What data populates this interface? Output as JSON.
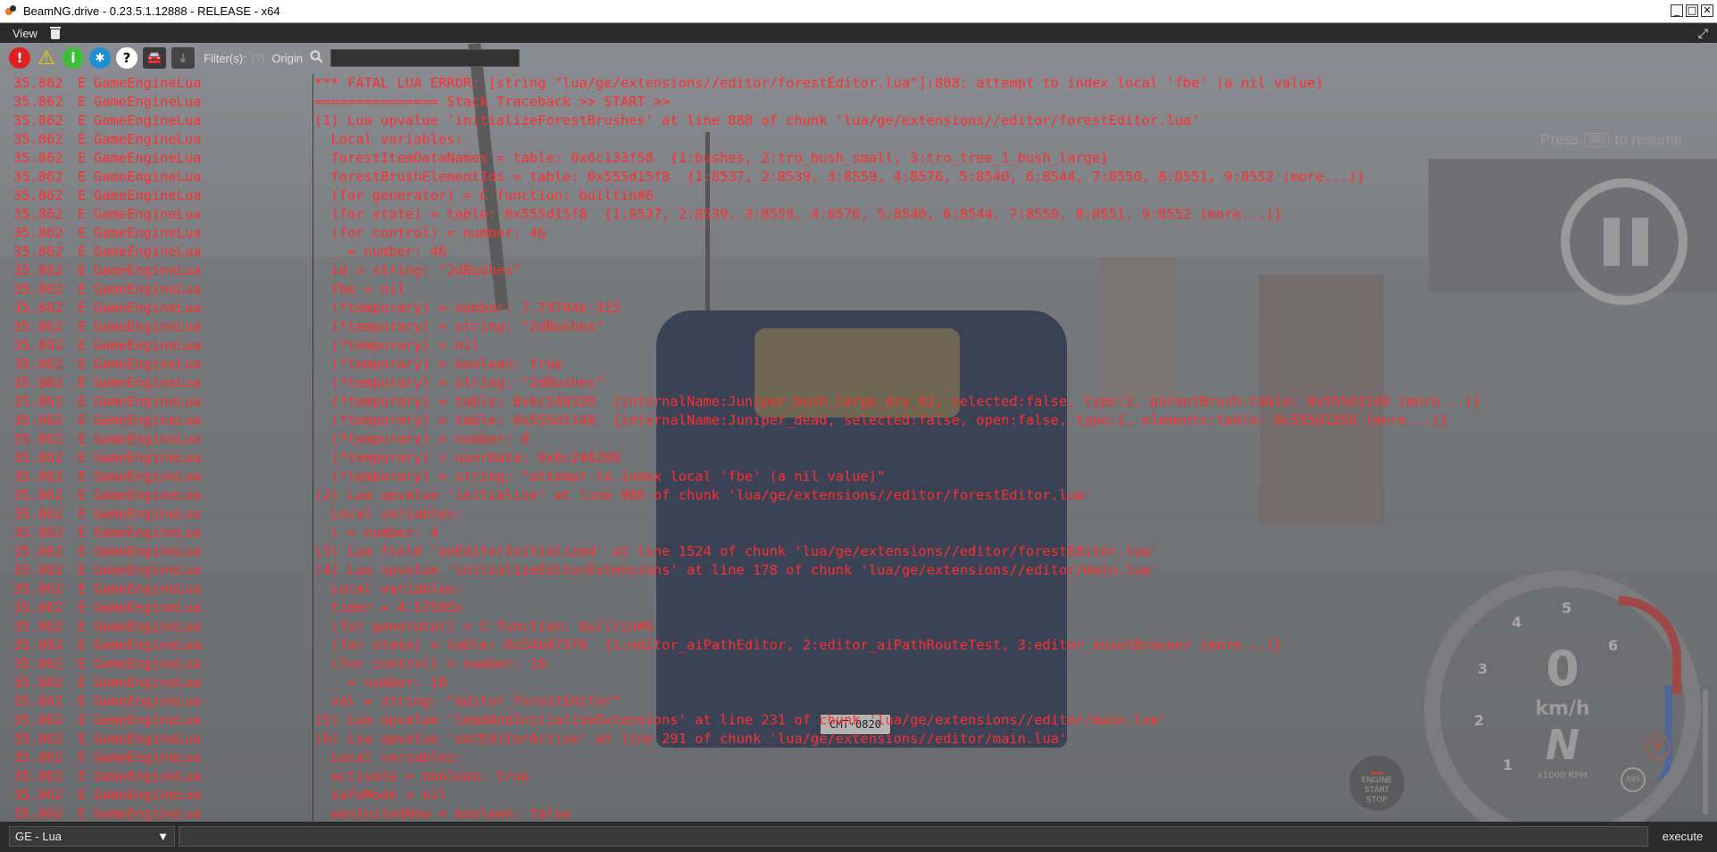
{
  "window": {
    "title": "BeamNG.drive - 0.23.5.1.12888 - RELEASE - x64",
    "minimize": "_",
    "maximize": "□",
    "close": "✕"
  },
  "menubar": {
    "view_label": "View",
    "expand_glyph": "⤢"
  },
  "toolbar": {
    "error_glyph": "!",
    "warning_glyph": "⚠",
    "info_glyph": "i",
    "debug_glyph": "✱",
    "help_glyph": "?",
    "car_glyph": "🚘",
    "download_glyph": "⤓",
    "filter_label": "Filter(s):",
    "filter_hint": "(?)",
    "origin_label": "Origin",
    "search_icon": "search-icon",
    "search_value": ""
  },
  "log": {
    "rows": [
      {
        "t": "35.862",
        "l": "E",
        "s": "GameEngineLua",
        "m": "*** FATAL LUA ERROR: [string \"lua/ge/extensions//editor/forestEditor.lua\"]:888: attempt to index local 'fbe' (a nil value)"
      },
      {
        "t": "35.862",
        "l": "E",
        "s": "GameEngineLua",
        "m": "=============== Stack Traceback >> START >>"
      },
      {
        "t": "35.862",
        "l": "E",
        "s": "GameEngineLua",
        "m": "(1) Lua upvalue 'initializeForestBrushes' at line 888 of chunk 'lua/ge/extensions//editor/forestEditor.lua'"
      },
      {
        "t": "35.862",
        "l": "E",
        "s": "GameEngineLua",
        "m": "  Local variables:"
      },
      {
        "t": "35.862",
        "l": "E",
        "s": "GameEngineLua",
        "m": "  forestItemDataNames = table: 0x6c133f58  {1:bushes, 2:tro_bush_small, 3:tro_tree_1_bush_large}"
      },
      {
        "t": "35.862",
        "l": "E",
        "s": "GameEngineLua",
        "m": "  forestBrushElementIds = table: 0x555d15f8  {1:8537, 2:8539, 3:8559, 4:8576, 5:8540, 6:8544, 7:8550, 8:8551, 9:8552 (more...)}"
      },
      {
        "t": "35.862",
        "l": "E",
        "s": "GameEngineLua",
        "m": "  (for generator) = C function: builtin#6"
      },
      {
        "t": "35.862",
        "l": "E",
        "s": "GameEngineLua",
        "m": "  (for state) = table: 0x555d15f8  {1:8537, 2:8539, 3:8559, 4:8576, 5:8540, 6:8544, 7:8550, 8:8551, 9:8552 (more...)}"
      },
      {
        "t": "35.862",
        "l": "E",
        "s": "GameEngineLua",
        "m": "  (for control) = number: 46"
      },
      {
        "t": "35.862",
        "l": "E",
        "s": "GameEngineLua",
        "m": "  _ = number: 46"
      },
      {
        "t": "35.862",
        "l": "E",
        "s": "GameEngineLua",
        "m": "  id = string: \"2dBushes\""
      },
      {
        "t": "35.862",
        "l": "E",
        "s": "GameEngineLua",
        "m": "  fbe = nil"
      },
      {
        "t": "35.862",
        "l": "E",
        "s": "GameEngineLua",
        "m": "  (*temporary) = number: 7.79794e-315"
      },
      {
        "t": "35.862",
        "l": "E",
        "s": "GameEngineLua",
        "m": "  (*temporary) = string: \"2dBushes\""
      },
      {
        "t": "35.862",
        "l": "E",
        "s": "GameEngineLua",
        "m": "  (*temporary) = nil"
      },
      {
        "t": "35.862",
        "l": "E",
        "s": "GameEngineLua",
        "m": "  (*temporary) = boolean: true"
      },
      {
        "t": "35.862",
        "l": "E",
        "s": "GameEngineLua",
        "m": "  (*temporary) = string: \"2dBushes\""
      },
      {
        "t": "35.862",
        "l": "E",
        "s": "GameEngineLua",
        "m": "  (*temporary) = table: 0x6c248320  {internalName:Juniper_bush_large_dry_02, selected:false, type:2, parentBrush:table: 0x555d1148 (more...)}"
      },
      {
        "t": "35.862",
        "l": "E",
        "s": "GameEngineLua",
        "m": "  (*temporary) = table: 0x555d1148  {internalName:Juniper_dead, selected:false, open:false, type:1, elements:table: 0x555d1258 (more...)}"
      },
      {
        "t": "35.862",
        "l": "E",
        "s": "GameEngineLua",
        "m": "  (*temporary) = number: 8"
      },
      {
        "t": "35.862",
        "l": "E",
        "s": "GameEngineLua",
        "m": "  (*temporary) = userdata: 0x6c248280"
      },
      {
        "t": "35.862",
        "l": "E",
        "s": "GameEngineLua",
        "m": "  (*temporary) = string: \"attempt to index local 'fbe' (a nil value)\""
      },
      {
        "t": "35.862",
        "l": "E",
        "s": "GameEngineLua",
        "m": "(2) Lua upvalue 'initialize' at line 986 of chunk 'lua/ge/extensions//editor/forestEditor.lua'"
      },
      {
        "t": "35.862",
        "l": "E",
        "s": "GameEngineLua",
        "m": "  Local variables:"
      },
      {
        "t": "35.862",
        "l": "E",
        "s": "GameEngineLua",
        "m": "  i = number: 4"
      },
      {
        "t": "35.862",
        "l": "E",
        "s": "GameEngineLua",
        "m": "(3) Lua field 'onEditorInitialized' at line 1524 of chunk 'lua/ge/extensions//editor/forestEditor.lua'"
      },
      {
        "t": "35.862",
        "l": "E",
        "s": "GameEngineLua",
        "m": "(4) Lua upvalue 'initializeEditorExtensions' at line 178 of chunk 'lua/ge/extensions//editor/main.lua'"
      },
      {
        "t": "35.862",
        "l": "E",
        "s": "GameEngineLua",
        "m": "  Local variables:"
      },
      {
        "t": "35.862",
        "l": "E",
        "s": "GameEngineLua",
        "m": "  timer = 4.57595s"
      },
      {
        "t": "35.862",
        "l": "E",
        "s": "GameEngineLua",
        "m": "  (for generator) = C function: builtin#6"
      },
      {
        "t": "35.862",
        "l": "E",
        "s": "GameEngineLua",
        "m": "  (for state) = table: 0x54b875f0  {1:editor_aiPathEditor, 2:editor_aiPathRouteTest, 3:editor_assetBrowser (more...)}"
      },
      {
        "t": "35.862",
        "l": "E",
        "s": "GameEngineLua",
        "m": "  (for control) = number: 18"
      },
      {
        "t": "35.862",
        "l": "E",
        "s": "GameEngineLua",
        "m": "  _ = number: 18"
      },
      {
        "t": "35.862",
        "l": "E",
        "s": "GameEngineLua",
        "m": "  val = string: \"editor_forestEditor\""
      },
      {
        "t": "35.862",
        "l": "E",
        "s": "GameEngineLua",
        "m": "(5) Lua upvalue 'loadAndInitializeExtensions' at line 231 of chunk 'lua/ge/extensions//editor/main.lua'"
      },
      {
        "t": "35.862",
        "l": "E",
        "s": "GameEngineLua",
        "m": "(6) Lua upvalue 'setEditorActive' at line 291 of chunk 'lua/ge/extensions//editor/main.lua'"
      },
      {
        "t": "35.862",
        "l": "E",
        "s": "GameEngineLua",
        "m": "  Local variables:"
      },
      {
        "t": "35.862",
        "l": "E",
        "s": "GameEngineLua",
        "m": "  activate = boolean: true"
      },
      {
        "t": "35.862",
        "l": "E",
        "s": "GameEngineLua",
        "m": "  safeMode = nil"
      },
      {
        "t": "35.862",
        "l": "E",
        "s": "GameEngineLua",
        "m": "  wasInitedNow = boolean: false"
      }
    ],
    "color": "#ff3030"
  },
  "hud": {
    "press_label": "Press",
    "press_key": "⌨3",
    "resume_label": "to resume",
    "speed": "0",
    "speed_unit": "km/h",
    "gear": "N",
    "rpm_label": "x1000 RPM",
    "ticks": [
      "1",
      "2",
      "3",
      "4",
      "5",
      "6"
    ],
    "parking": "P",
    "abs": "ABS",
    "engine_line1": "ENGINE",
    "engine_line2": "START",
    "engine_line3": "STOP",
    "plate": "CMT·0820"
  },
  "bottombar": {
    "context_value": "GE - Lua",
    "context_arrow": "▼",
    "command_value": "",
    "execute_label": "execute"
  }
}
